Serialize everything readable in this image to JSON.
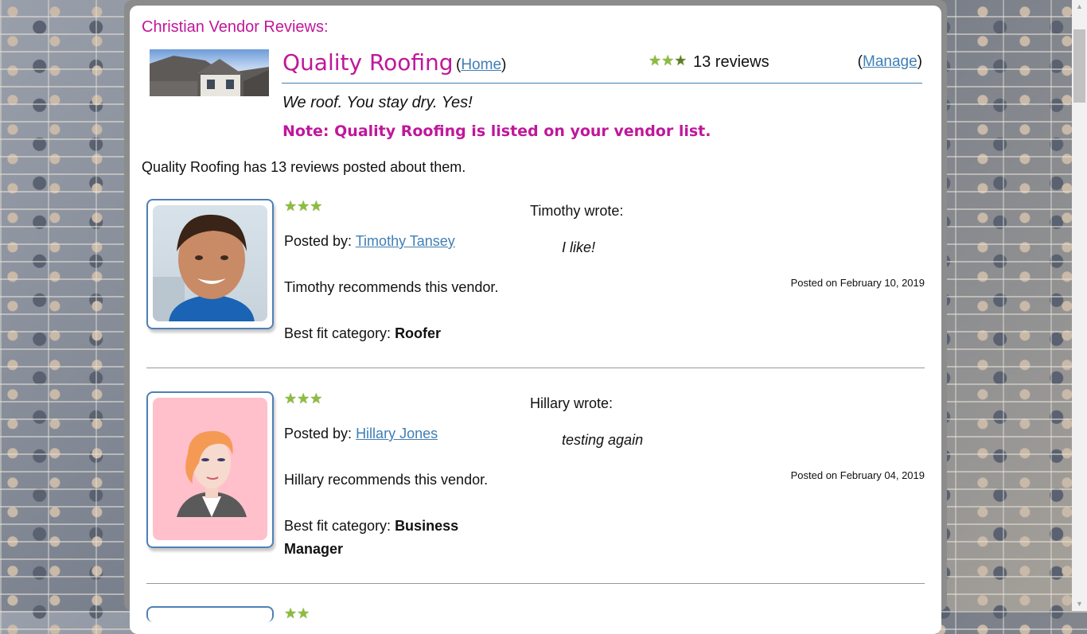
{
  "site": {
    "title": "Christian Vendor Reviews:"
  },
  "vendor": {
    "name": "Quality Roofing",
    "home_label": "Home",
    "review_count": "13 reviews",
    "manage_label": "Manage",
    "tagline": "We roof. You stay dry. Yes!",
    "note": "Note: Quality Roofing is listed on your vendor list.",
    "rating_stars": 2.5
  },
  "summary": "Quality Roofing has 13 reviews posted about them.",
  "reviews": [
    {
      "stars": 3,
      "posted_by_label": "Posted by: ",
      "author": "Timothy Tansey",
      "recommends": "Timothy recommends this vendor.",
      "category_label": "Best fit category: ",
      "category": "Roofer",
      "wrote": "Timothy wrote:",
      "text": "I like!",
      "date": "Posted on February 10, 2019"
    },
    {
      "stars": 3,
      "posted_by_label": "Posted by: ",
      "author": "Hillary Jones",
      "recommends": "Hillary recommends this vendor.",
      "category_label": "Best fit category: ",
      "category": "Business Manager",
      "wrote": "Hillary wrote:",
      "text": "testing again",
      "date": "Posted on February 04, 2019"
    }
  ],
  "colors": {
    "accent": "#c0179a",
    "link": "#3f7fb5",
    "star": "#8cbd3c"
  }
}
